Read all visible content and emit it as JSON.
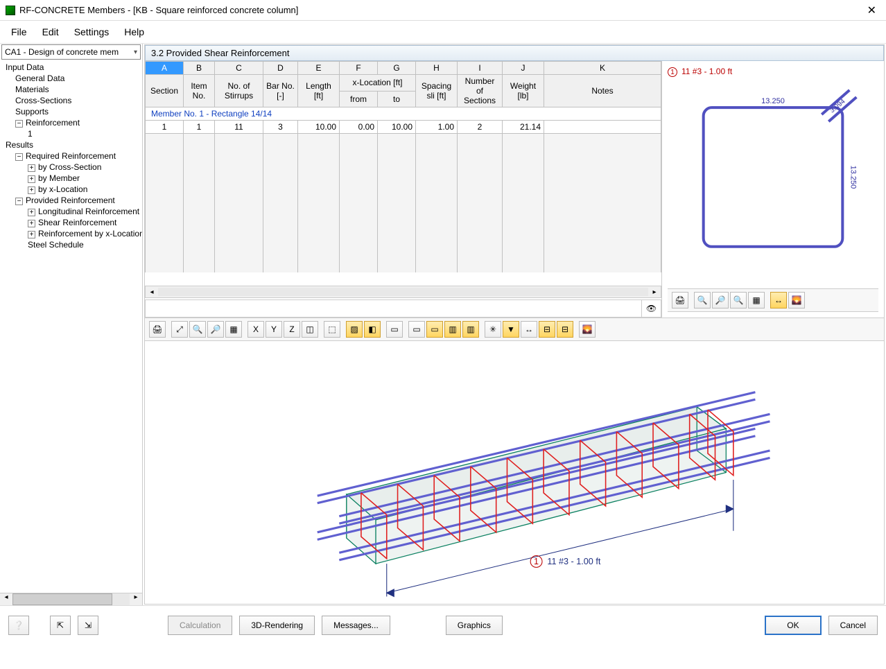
{
  "window": {
    "title": "RF-CONCRETE Members - [KB - Square reinforced concrete column]",
    "close": "✕"
  },
  "menu": {
    "file": "File",
    "edit": "Edit",
    "settings": "Settings",
    "help": "Help"
  },
  "sidebar": {
    "combo": "CA1 - Design of concrete mem",
    "input_data": "Input Data",
    "general_data": "General Data",
    "materials": "Materials",
    "cross_sections": "Cross-Sections",
    "supports": "Supports",
    "reinforcement": "Reinforcement",
    "reinf_1": "1",
    "results": "Results",
    "req_reinf": "Required Reinforcement",
    "by_cs": "by Cross-Section",
    "by_member": "by Member",
    "by_xloc": "by x-Location",
    "prov_reinf": "Provided Reinforcement",
    "long_reinf": "Longitudinal Reinforcement",
    "shear_reinf": "Shear Reinforcement",
    "reinf_by_xloc": "Reinforcement by x-Location",
    "steel_sched": "Steel Schedule"
  },
  "content": {
    "title": "3.2  Provided Shear Reinforcement",
    "cols_letters": [
      "A",
      "B",
      "C",
      "D",
      "E",
      "F",
      "G",
      "H",
      "I",
      "J",
      "K"
    ],
    "headers": {
      "section": "Section",
      "item_no": "Item\nNo.",
      "no_stirrups": "No. of\nStirrups",
      "bar_no": "Bar No.\n[-]",
      "length": "Length\n[ft]",
      "xloc": "x-Location [ft]",
      "from": "from",
      "to": "to",
      "spacing": "Spacing\nsli [ft]",
      "num_sec": "Number of\nSections",
      "weight": "Weight\n[lb]",
      "notes": "Notes"
    },
    "group_row": "Member No. 1  -  Rectangle 14/14",
    "row": {
      "section": "1",
      "item_no": "1",
      "no_stirrups": "11",
      "bar_no": "3",
      "length": "10.00",
      "from": "0.00",
      "to": "10.00",
      "spacing": "1.00",
      "num_sec": "2",
      "weight": "21.14",
      "notes": ""
    }
  },
  "preview": {
    "label_num": "1",
    "label_text": "11 #3 - 1.00 ft",
    "dim_top": "13.250",
    "dim_right": "13.250",
    "dim_corner": "3.094"
  },
  "render_label": "11 #3 - 1.00 ft",
  "render_label_num": "1",
  "footer": {
    "calculation": "Calculation",
    "rendering": "3D-Rendering",
    "messages": "Messages...",
    "graphics": "Graphics",
    "ok": "OK",
    "cancel": "Cancel"
  }
}
